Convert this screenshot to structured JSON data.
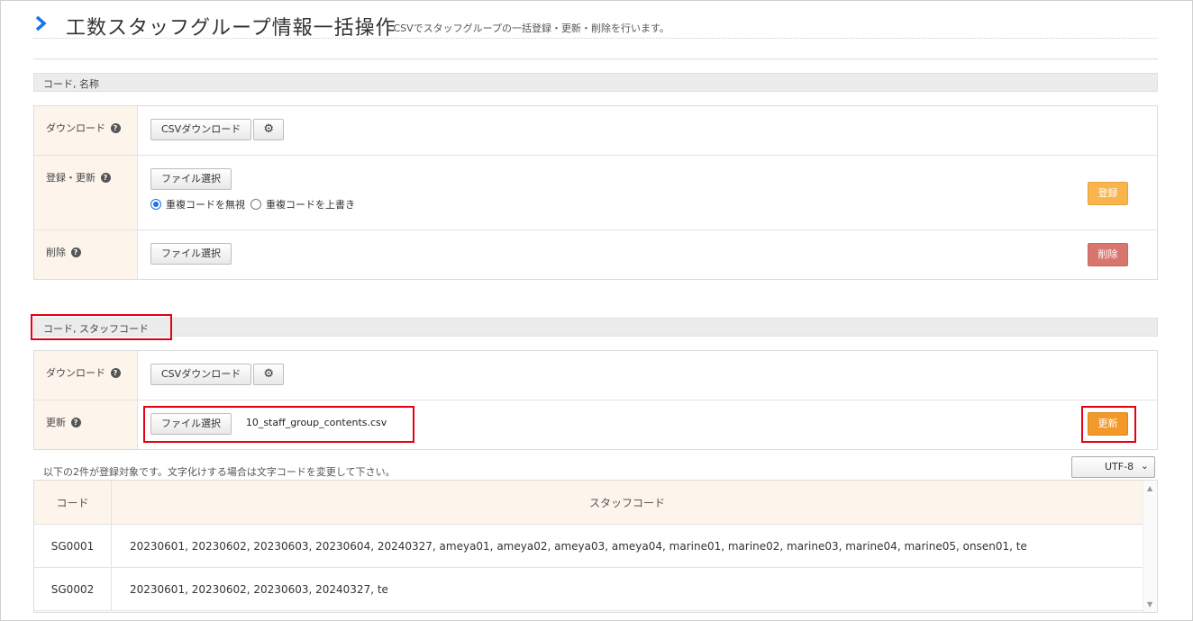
{
  "page": {
    "title": "工数スタッフグループ情報一括操作",
    "subtitle": "- CSVでスタッフグループの一括登録・更新・削除を行います。"
  },
  "section1": {
    "heading": "コード, 名称",
    "download": {
      "label": "ダウンロード",
      "csv_button": "CSVダウンロード"
    },
    "register": {
      "label": "登録・更新",
      "file_button": "ファイル選択",
      "radio_ignore": "重複コードを無視",
      "radio_overwrite": "重複コードを上書き",
      "radio_selected": "ignore",
      "submit": "登録"
    },
    "delete": {
      "label": "削除",
      "file_button": "ファイル選択",
      "submit": "削除"
    }
  },
  "section2": {
    "heading": "コード, スタッフコード",
    "download": {
      "label": "ダウンロード",
      "csv_button": "CSVダウンロード"
    },
    "update": {
      "label": "更新",
      "file_button": "ファイル選択",
      "file_name": "10_staff_group_contents.csv",
      "submit": "更新"
    }
  },
  "notice": "以下の2件が登録対象です。文字化けする場合は文字コードを変更して下さい。",
  "encoding": {
    "selected": "UTF-8"
  },
  "table": {
    "headers": {
      "code": "コード",
      "staff": "スタッフコード"
    },
    "rows": [
      {
        "code": "SG0001",
        "staff": "20230601, 20230602, 20230603, 20230604, 20240327, ameya01, ameya02, ameya03, ameya04, marine01, marine02, marine03, marine04, marine05, onsen01, te"
      },
      {
        "code": "SG0002",
        "staff": "20230601, 20230602, 20230603, 20240327, te"
      }
    ]
  },
  "colors": {
    "accent": "#1a73e8",
    "register": "#f9b54c",
    "delete": "#d9756f",
    "update": "#f3992a",
    "highlight": "#e60012",
    "label_bg": "#fdf5ec"
  }
}
